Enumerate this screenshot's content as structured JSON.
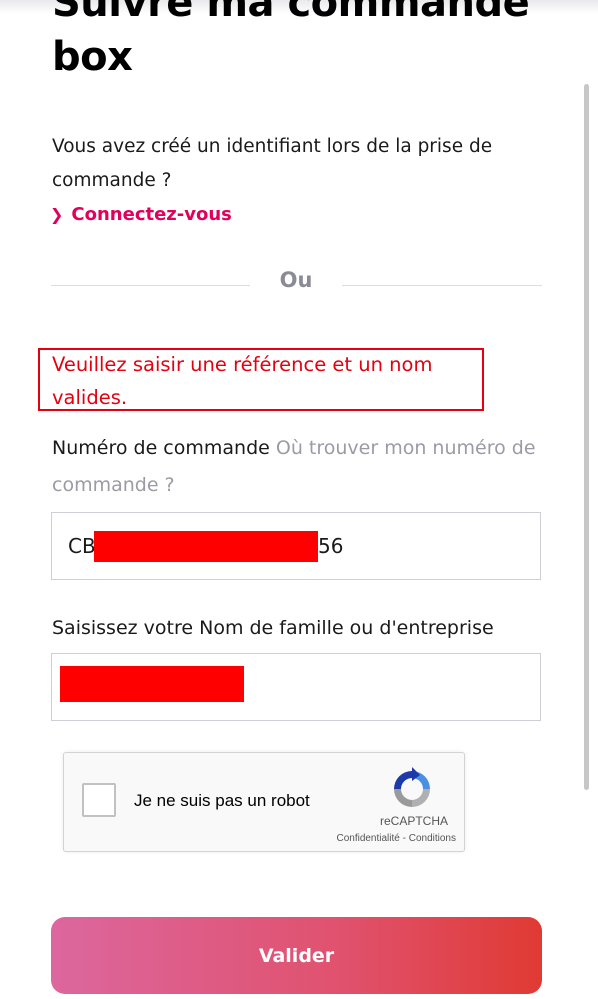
{
  "header": {
    "title": "Suivre ma commande box"
  },
  "intro": {
    "question": "Vous avez créé un identifiant lors de la prise de commande ?",
    "login_link": "Connectez-vous"
  },
  "divider": {
    "label": "Ou"
  },
  "error": {
    "message": "Veuillez saisir une référence et un nom valides."
  },
  "order_field": {
    "label": "Numéro de commande",
    "help_link": "Où trouver mon numéro de commande ?",
    "value_prefix": "CB",
    "value_suffix": "56"
  },
  "name_field": {
    "label": "Saisissez votre Nom de famille ou d'entreprise"
  },
  "captcha": {
    "label": "Je ne suis pas un robot",
    "brand": "reCAPTCHA",
    "privacy": "Confidentialité",
    "separator": " - ",
    "terms": "Conditions"
  },
  "submit": {
    "label": "Valider"
  },
  "colors": {
    "brand_pink": "#e2005a",
    "error_red": "#e4000f",
    "muted": "#8b8b96"
  }
}
